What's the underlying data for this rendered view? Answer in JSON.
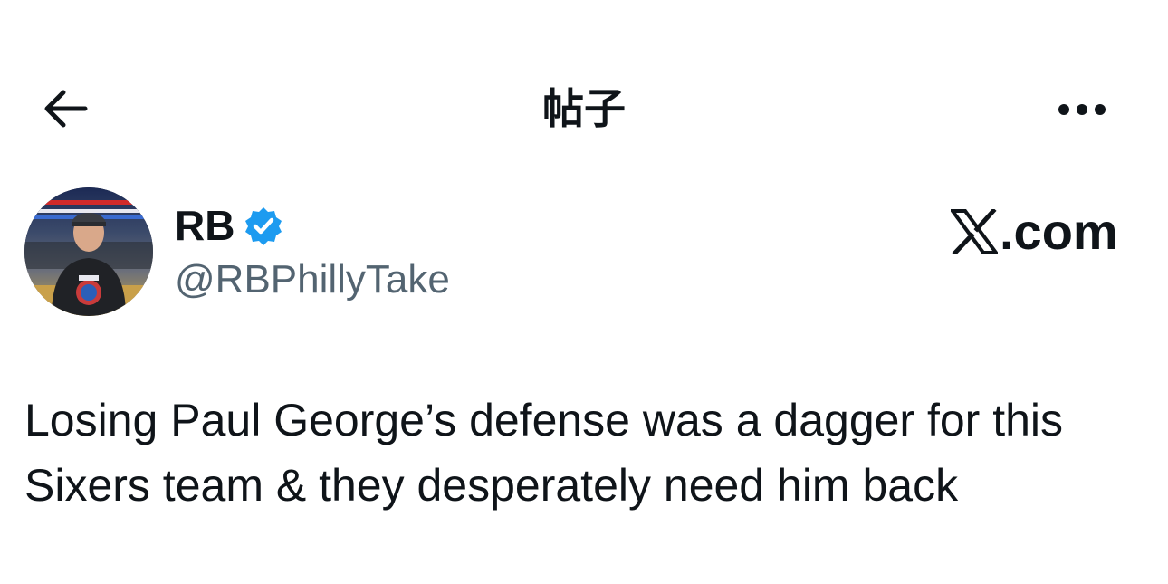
{
  "header": {
    "title": "帖子",
    "back_icon": "arrow-left-icon",
    "more_icon": "more-horizontal-icon"
  },
  "author": {
    "display_name": "RB",
    "handle": "@RBPhillyTake",
    "verified": true,
    "verified_color": "#1d9bf0"
  },
  "watermark": {
    "text": ".com",
    "logo": "x-logo"
  },
  "tweet": {
    "text": "Losing Paul George’s defense was a dagger for this Sixers team & they desperately need him back"
  },
  "colors": {
    "text_primary": "#0f1419",
    "text_secondary": "#536471",
    "background": "#ffffff"
  }
}
